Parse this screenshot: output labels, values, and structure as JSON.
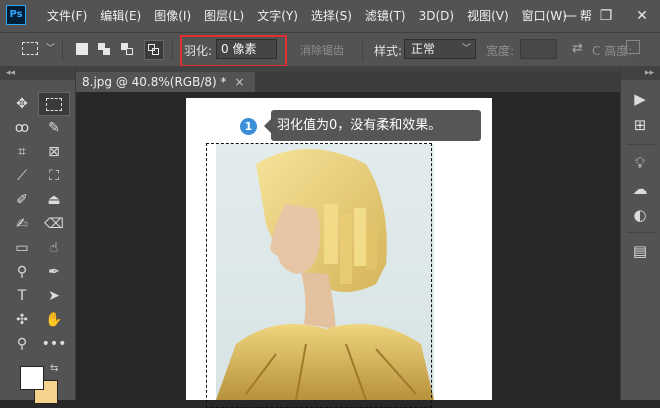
{
  "app": {
    "logo_text": "Ps"
  },
  "menu": {
    "items": [
      "文件(F)",
      "编辑(E)",
      "图像(I)",
      "图层(L)",
      "文字(Y)",
      "选择(S)",
      "滤镜(T)",
      "3D(D)",
      "视图(V)",
      "窗口(W)",
      "帮"
    ]
  },
  "window_controls": {
    "minimize": "—",
    "restore": "❐",
    "close": "✕"
  },
  "options": {
    "feather_label": "羽化:",
    "feather_value": "0 像素",
    "antialias_label": "消除锯齿",
    "style_label": "样式:",
    "style_value": "正常",
    "width_label": "宽度:",
    "height_label": "C 高度:"
  },
  "document": {
    "tab_title": "8.jpg @ 40.8%(RGB/8) *",
    "tab_close": "×"
  },
  "callout": {
    "number": "1",
    "text": "羽化值为0，没有柔和效果。"
  },
  "colors": {
    "foreground": "#ffffff",
    "background": "#f5d38c",
    "highlight_box": "#e03030",
    "callout_badge": "#3a8fd8"
  },
  "toolbar": {
    "tools": [
      "move-icon",
      "rect-marquee-icon",
      "lasso-icon",
      "quick-select-icon",
      "crop-icon",
      "frame-icon",
      "eyedropper-icon",
      "patch-icon",
      "brush-icon",
      "stamp-icon",
      "history-brush-icon",
      "eraser-icon",
      "gradient-icon",
      "smudge-icon",
      "dodge-icon",
      "pen-icon",
      "type-icon",
      "path-select-icon",
      "shape-icon",
      "hand-icon",
      "zoom-icon",
      "more-icon"
    ]
  },
  "dock": {
    "icons": [
      "play-icon",
      "grid-icon",
      "bulb-icon",
      "cc-libraries-icon",
      "adjust-icon",
      "channels-icon"
    ]
  }
}
